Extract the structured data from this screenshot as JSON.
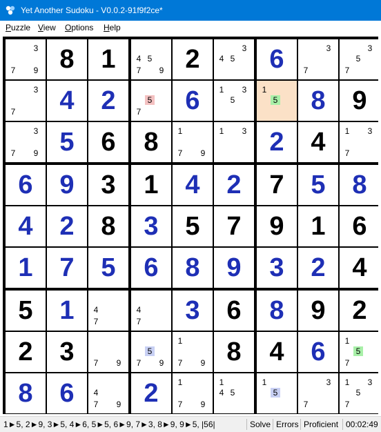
{
  "window": {
    "title": "Yet Another Sudoku - V0.0.2-91f9f2ce*",
    "icon": "sudoku-app-icon"
  },
  "menu": [
    {
      "accel": "P",
      "rest": "uzzle"
    },
    {
      "accel": "V",
      "rest": "iew"
    },
    {
      "accel": "O",
      "rest": "ptions"
    },
    {
      "accel": "H",
      "rest": "elp"
    }
  ],
  "colors": {
    "given": "#000000",
    "user": "#1e2fb5",
    "selected_cell": "#fbe1c7",
    "highlight_red": "#f4c1c1",
    "highlight_green": "#a8f0a8",
    "highlight_blue": "#c8d0f4",
    "titlebar": "#0078d7"
  },
  "grid": [
    [
      {
        "c": [
          "3",
          "7",
          "9"
        ]
      },
      {
        "v": "8",
        "t": "given"
      },
      {
        "v": "1",
        "t": "given"
      },
      {
        "c": [
          "4",
          "5",
          "7",
          "9"
        ]
      },
      {
        "v": "2",
        "t": "given"
      },
      {
        "c": [
          "3",
          "4",
          "5"
        ]
      },
      {
        "v": "6",
        "t": "user"
      },
      {
        "c": [
          "3",
          "7"
        ]
      },
      {
        "c": [
          "3",
          "5",
          "7"
        ]
      }
    ],
    [
      {
        "c": [
          "3",
          "7"
        ]
      },
      {
        "v": "4",
        "t": "user"
      },
      {
        "v": "2",
        "t": "user"
      },
      {
        "c": [
          "5",
          "7"
        ],
        "hl": {
          "5": "red"
        }
      },
      {
        "v": "6",
        "t": "user"
      },
      {
        "c": [
          "1",
          "3",
          "5"
        ]
      },
      {
        "c": [
          "1",
          "5"
        ],
        "hl": {
          "5": "green"
        },
        "sel": true
      },
      {
        "v": "8",
        "t": "user"
      },
      {
        "v": "9",
        "t": "given"
      }
    ],
    [
      {
        "c": [
          "3",
          "7",
          "9"
        ]
      },
      {
        "v": "5",
        "t": "user"
      },
      {
        "v": "6",
        "t": "given"
      },
      {
        "v": "8",
        "t": "given"
      },
      {
        "c": [
          "1",
          "7",
          "9"
        ]
      },
      {
        "c": [
          "1",
          "3"
        ]
      },
      {
        "v": "2",
        "t": "user"
      },
      {
        "v": "4",
        "t": "given"
      },
      {
        "c": [
          "1",
          "3",
          "7"
        ]
      }
    ],
    [
      {
        "v": "6",
        "t": "user"
      },
      {
        "v": "9",
        "t": "user"
      },
      {
        "v": "3",
        "t": "given"
      },
      {
        "v": "1",
        "t": "given"
      },
      {
        "v": "4",
        "t": "user"
      },
      {
        "v": "2",
        "t": "user"
      },
      {
        "v": "7",
        "t": "given"
      },
      {
        "v": "5",
        "t": "user"
      },
      {
        "v": "8",
        "t": "user"
      }
    ],
    [
      {
        "v": "4",
        "t": "user"
      },
      {
        "v": "2",
        "t": "user"
      },
      {
        "v": "8",
        "t": "given"
      },
      {
        "v": "3",
        "t": "user"
      },
      {
        "v": "5",
        "t": "given"
      },
      {
        "v": "7",
        "t": "given"
      },
      {
        "v": "9",
        "t": "given"
      },
      {
        "v": "1",
        "t": "given"
      },
      {
        "v": "6",
        "t": "given"
      }
    ],
    [
      {
        "v": "1",
        "t": "user"
      },
      {
        "v": "7",
        "t": "user"
      },
      {
        "v": "5",
        "t": "user"
      },
      {
        "v": "6",
        "t": "user"
      },
      {
        "v": "8",
        "t": "user"
      },
      {
        "v": "9",
        "t": "user"
      },
      {
        "v": "3",
        "t": "user"
      },
      {
        "v": "2",
        "t": "user"
      },
      {
        "v": "4",
        "t": "given"
      }
    ],
    [
      {
        "v": "5",
        "t": "given"
      },
      {
        "v": "1",
        "t": "user"
      },
      {
        "c": [
          "4",
          "7"
        ]
      },
      {
        "c": [
          "4",
          "7"
        ]
      },
      {
        "v": "3",
        "t": "user"
      },
      {
        "v": "6",
        "t": "given"
      },
      {
        "v": "8",
        "t": "user"
      },
      {
        "v": "9",
        "t": "given"
      },
      {
        "v": "2",
        "t": "given"
      }
    ],
    [
      {
        "v": "2",
        "t": "given"
      },
      {
        "v": "3",
        "t": "given"
      },
      {
        "c": [
          "7",
          "9"
        ]
      },
      {
        "c": [
          "5",
          "7",
          "9"
        ],
        "hl": {
          "5": "blue"
        }
      },
      {
        "c": [
          "1",
          "7",
          "9"
        ]
      },
      {
        "v": "8",
        "t": "given"
      },
      {
        "v": "4",
        "t": "given"
      },
      {
        "v": "6",
        "t": "user"
      },
      {
        "c": [
          "1",
          "5",
          "7"
        ],
        "hl": {
          "5": "green"
        }
      }
    ],
    [
      {
        "v": "8",
        "t": "user"
      },
      {
        "v": "6",
        "t": "user"
      },
      {
        "c": [
          "4",
          "7",
          "9"
        ]
      },
      {
        "v": "2",
        "t": "user"
      },
      {
        "c": [
          "1",
          "7",
          "9"
        ]
      },
      {
        "c": [
          "1",
          "4",
          "5"
        ]
      },
      {
        "c": [
          "1",
          "5"
        ],
        "hl": {
          "5": "blue"
        }
      },
      {
        "c": [
          "3",
          "7"
        ]
      },
      {
        "c": [
          "1",
          "3",
          "5",
          "7"
        ]
      }
    ]
  ],
  "status": {
    "counts": "1►5, 2►9, 3►5, 4►6, 5►5, 6►9, 7►3, 8►9, 9►5, |56|",
    "solve": "Solve",
    "errors": "Errors",
    "level": "Proficient",
    "timer": "00:02:49"
  }
}
